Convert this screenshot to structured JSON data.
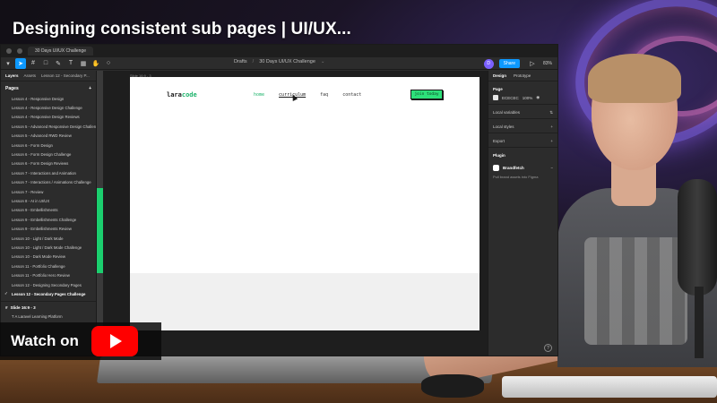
{
  "video": {
    "title": "Designing consistent sub pages | UI/UX...",
    "watch_label": "Watch on"
  },
  "figma": {
    "tabs": [
      "30 Days UI/UX Challenge"
    ],
    "breadcrumb": {
      "project": "Drafts",
      "file": "30 Days UI/UX Challenge"
    },
    "share_label": "Share",
    "avatar_initial": "D",
    "zoom": "83%",
    "left_panel": {
      "tabs": [
        "Layers",
        "Assets",
        "Lesson 12 - Secondary P..."
      ],
      "pages_heading": "Pages",
      "pages": [
        "Lesson 4 - Responsive Design",
        "Lesson 4 - Responsive Design Challenge",
        "Lesson 4 - Responsive Design Reviews",
        "Lesson 5 - Advanced Responsive Design Challenge",
        "Lesson 5 - Advanced RWD Review",
        "Lesson 6 - Form Design",
        "Lesson 6 - Form Design Challenge",
        "Lesson 6 - Form Design Reviews",
        "Lesson 7 - Interactions and Animation",
        "Lesson 7 - Interactions / Animations Challenge",
        "Lesson 7 - Review",
        "Lesson 8 - AI in UI/UX",
        "Lesson 9 - Embellishments",
        "Lesson 9 - Embellishments  Challenge",
        "Lesson 9 - Embellishments Review",
        "Lesson 10 - Light / Dark Mode",
        "Lesson 10 - Light / Dark Mode Challenge",
        "Lesson 10 - Dark Mode Review",
        "Lesson 11 - Portfolio Challenge",
        "Lesson 11 - Portfolio Hero Review",
        "Lesson 12 - Designing Secondary Pages",
        "Lesson 12 - Secondary Pages Challenge"
      ],
      "current_page_index": 21,
      "frame_name": "Slide 16:9 - 3",
      "layers": [
        "A Laravel Learning Platform"
      ]
    },
    "canvas": {
      "frame_label": "Slide 16:9 - 3",
      "site": {
        "logo_primary": "lara",
        "logo_accent": "code",
        "nav": [
          "home",
          "curriculum",
          "faq",
          "contact"
        ],
        "cta": "join today"
      }
    },
    "right_panel": {
      "tabs": [
        "Design",
        "Prototype"
      ],
      "page_heading": "Page",
      "page_color": "ECECEC",
      "page_opacity": "100%",
      "sections": [
        "Local variables",
        "Local styles",
        "Export"
      ],
      "plugin_heading": "Plugin",
      "plugin_name": "Brandfetch",
      "plugin_desc": "Pull brand assets into Figma"
    }
  }
}
